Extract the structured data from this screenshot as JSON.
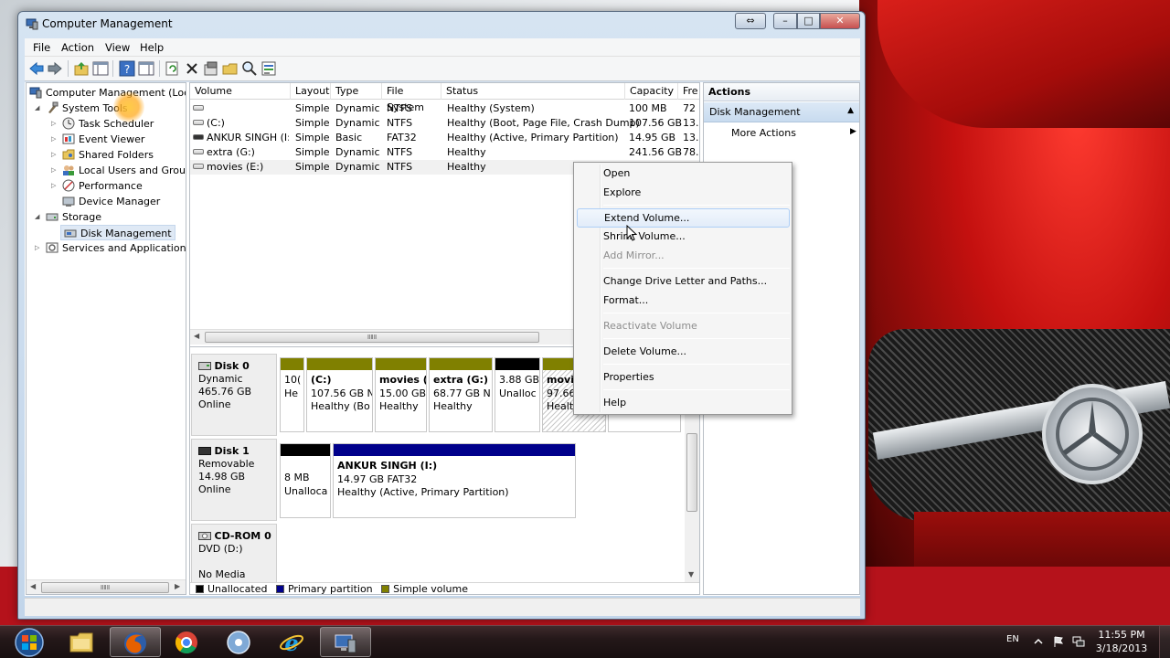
{
  "window": {
    "title": "Computer Management",
    "extra_glyph": "⇔",
    "min_glyph": "–",
    "max_glyph": "□",
    "close_glyph": "✕"
  },
  "menu": {
    "file": "File",
    "action": "Action",
    "view": "View",
    "help": "Help"
  },
  "toolbar": {
    "icons": [
      "back-arrow-icon",
      "forward-arrow-icon",
      "up-folder-icon",
      "show-hide-tree-icon",
      "help-icon",
      "details-icon",
      "refresh-icon",
      "delete-icon",
      "properties-icon",
      "open-icon",
      "search-icon",
      "rescan-icon"
    ]
  },
  "tree": {
    "root": "Computer Management (Local",
    "system_tools": "System Tools",
    "task_scheduler": "Task Scheduler",
    "event_viewer": "Event Viewer",
    "shared_folders": "Shared Folders",
    "local_users": "Local Users and Groups",
    "performance": "Performance",
    "device_manager": "Device Manager",
    "storage": "Storage",
    "disk_management": "Disk Management",
    "services": "Services and Applications"
  },
  "volumes": {
    "headers": [
      "Volume",
      "Layout",
      "Type",
      "File System",
      "Status",
      "Capacity",
      "Fre"
    ],
    "rows": [
      {
        "volume": "",
        "layout": "Simple",
        "type": "Dynamic",
        "fs": "NTFS",
        "status": "Healthy (System)",
        "capacity": "100 MB",
        "free": "72"
      },
      {
        "volume": "(C:)",
        "layout": "Simple",
        "type": "Dynamic",
        "fs": "NTFS",
        "status": "Healthy (Boot, Page File, Crash Dump)",
        "capacity": "107.56 GB",
        "free": "13."
      },
      {
        "volume": "ANKUR SINGH (I:)",
        "layout": "Simple",
        "type": "Basic",
        "fs": "FAT32",
        "status": "Healthy (Active, Primary Partition)",
        "capacity": "14.95 GB",
        "free": "13."
      },
      {
        "volume": "extra (G:)",
        "layout": "Simple",
        "type": "Dynamic",
        "fs": "NTFS",
        "status": "Healthy",
        "capacity": "241.56 GB",
        "free": "78."
      },
      {
        "volume": "movies (E:)",
        "layout": "Simple",
        "type": "Dynamic",
        "fs": "NTFS",
        "status": "Healthy",
        "capacity": "",
        "free": ""
      }
    ],
    "scroll_grip": "ⅡⅡⅡ"
  },
  "disks": {
    "disk0": {
      "name": "Disk 0",
      "kind": "Dynamic",
      "size": "465.76 GB",
      "state": "Online",
      "parts": [
        {
          "name": "",
          "l1": "10(",
          "l2": "He"
        },
        {
          "name": "(C:)",
          "l1": "107.56 GB N",
          "l2": "Healthy (Bo"
        },
        {
          "name": "movies (",
          "l1": "15.00 GB",
          "l2": "Healthy"
        },
        {
          "name": "extra  (G:)",
          "l1": "68.77 GB N",
          "l2": "Healthy"
        },
        {
          "name": "",
          "l1": "3.88 GB",
          "l2": "Unalloc"
        },
        {
          "name": "movie",
          "l1": "97.66",
          "l2": "Healtl"
        }
      ]
    },
    "disk1": {
      "name": "Disk 1",
      "kind": "Removable",
      "size": "14.98 GB",
      "state": "Online",
      "parts": [
        {
          "name": "",
          "l1": "8 MB",
          "l2": "Unalloca"
        },
        {
          "name": "ANKUR SINGH  (I:)",
          "l1": "14.97 GB FAT32",
          "l2": "Healthy (Active, Primary Partition)"
        }
      ]
    },
    "cdrom": {
      "name": "CD-ROM 0",
      "kind": "DVD (D:)",
      "state": "No Media"
    }
  },
  "legend": {
    "unallocated": "Unallocated",
    "primary": "Primary partition",
    "simple": "Simple volume",
    "colors": {
      "unallocated": "#000000",
      "primary": "#00008b",
      "simple": "#808000"
    }
  },
  "actions": {
    "title": "Actions",
    "section": "Disk Management",
    "more": "More Actions"
  },
  "context_menu": {
    "open": "Open",
    "explore": "Explore",
    "extend": "Extend Volume...",
    "shrink": "Shrink Volume...",
    "add_mirror": "Add Mirror...",
    "change_letter": "Change Drive Letter and Paths...",
    "format": "Format...",
    "reactivate": "Reactivate Volume",
    "delete": "Delete Volume...",
    "properties": "Properties",
    "help": "Help"
  },
  "taskbar": {
    "apps": [
      "windows-explorer-icon",
      "firefox-icon",
      "chrome-icon",
      "media-player-icon",
      "internet-explorer-icon",
      "computer-management-icon"
    ],
    "lang": "EN",
    "time": "11:55 PM",
    "date": "3/18/2013"
  }
}
